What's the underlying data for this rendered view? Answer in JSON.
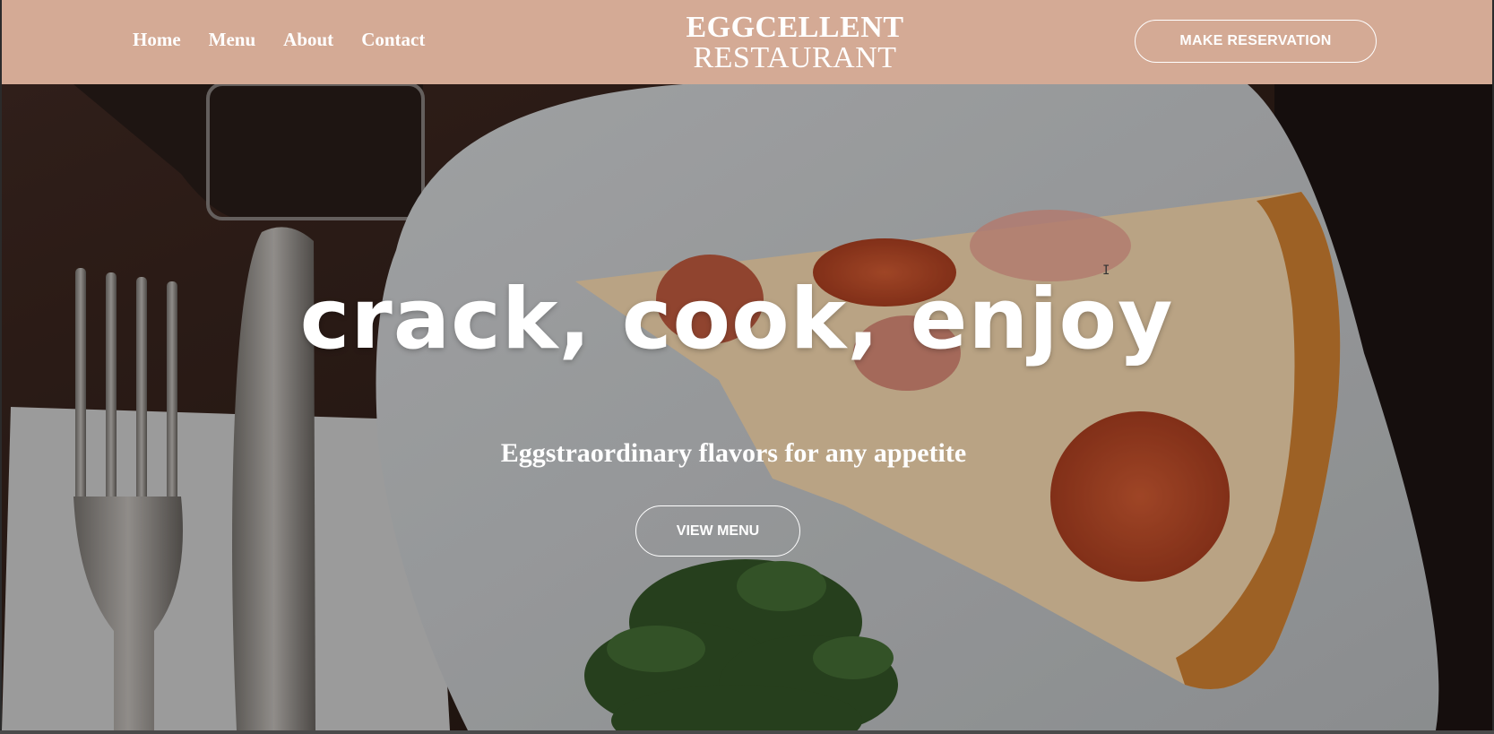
{
  "header": {
    "nav": [
      {
        "label": "Home"
      },
      {
        "label": "Menu"
      },
      {
        "label": "About"
      },
      {
        "label": "Contact"
      }
    ],
    "logo_line1": "EGGCELLENT",
    "logo_line2": "RESTAURANT",
    "reserve_label": "MAKE RESERVATION"
  },
  "hero": {
    "title": "crack, cook, enjoy",
    "subtitle": "Eggstraordinary flavors for any appetite",
    "menu_button_label": "VIEW MENU"
  },
  "colors": {
    "header_bg": "#d4aa95",
    "text": "#ffffff"
  }
}
